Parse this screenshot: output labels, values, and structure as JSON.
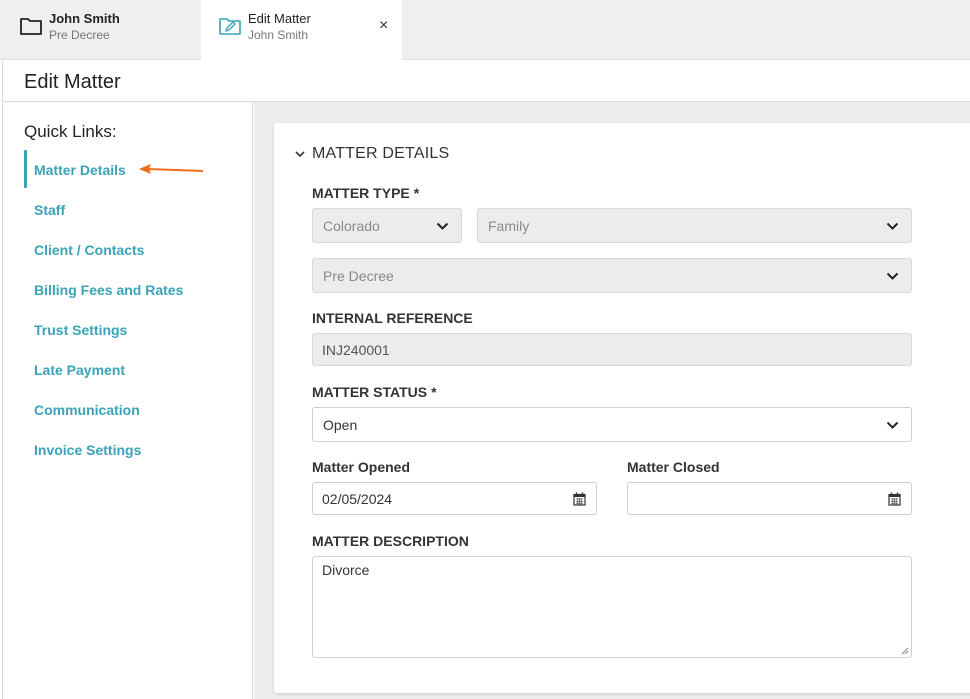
{
  "tabs": [
    {
      "title": "John Smith",
      "subtitle": "Pre Decree",
      "icon": "folder-icon"
    },
    {
      "title": "Edit Matter",
      "subtitle": "John Smith",
      "icon": "folder-edit-icon",
      "close": "×"
    }
  ],
  "page": {
    "title": "Edit Matter"
  },
  "sidebar": {
    "title": "Quick Links:",
    "active_index": 0,
    "items": [
      {
        "label": "Matter Details"
      },
      {
        "label": "Staff"
      },
      {
        "label": "Client / Contacts"
      },
      {
        "label": "Billing Fees and Rates"
      },
      {
        "label": "Trust Settings"
      },
      {
        "label": "Late Payment"
      },
      {
        "label": "Communication"
      },
      {
        "label": "Invoice Settings"
      }
    ]
  },
  "section": {
    "title": "MATTER DETAILS",
    "matter_type_label": "MATTER TYPE",
    "required_mark": "*",
    "state_value": "Colorado",
    "type_value": "Family",
    "subtype_value": "Pre Decree",
    "internal_reference_label": "INTERNAL REFERENCE",
    "internal_reference_value": "INJ240001",
    "status_label": "MATTER STATUS",
    "status_value": "Open",
    "opened_label": "Matter Opened",
    "opened_value": "02/05/2024",
    "closed_label": "Matter Closed",
    "closed_value": "",
    "description_label": "MATTER DESCRIPTION",
    "description_value": "Divorce"
  },
  "colors": {
    "accent": "#3aa3b8",
    "arrow": "#f26a1b"
  }
}
